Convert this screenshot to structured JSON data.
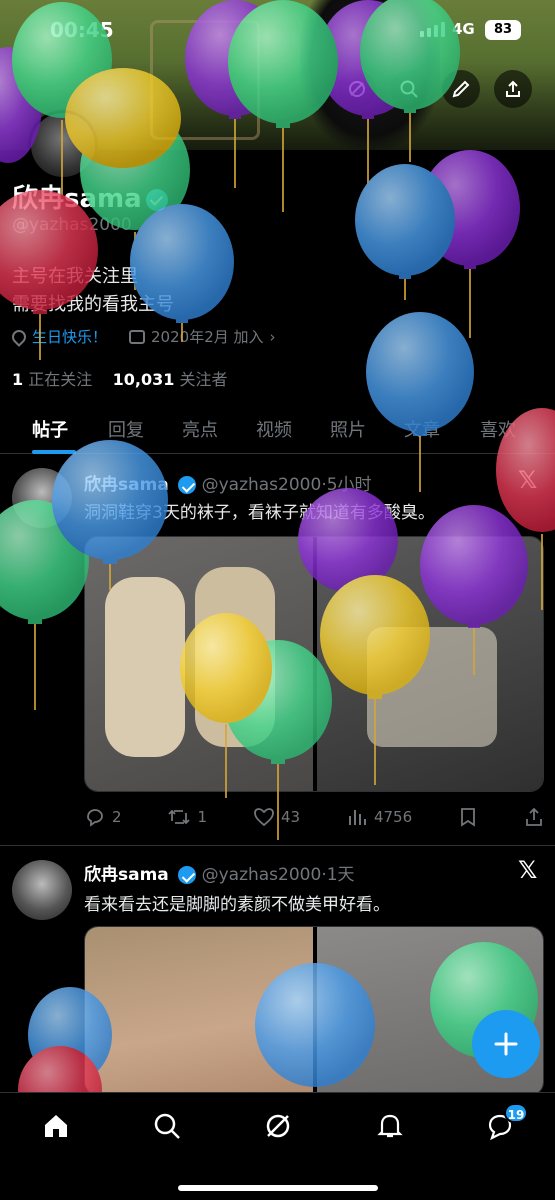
{
  "status_bar": {
    "time": "00:45",
    "network": "4G",
    "battery": "83"
  },
  "profile": {
    "name": "欣冉sama",
    "handle": "@yazhas2000",
    "bio_line1": "主号在我关注里",
    "bio_line2": "需要找我的看我主号",
    "birthday": "生日快乐！",
    "joined": "2020年2月 加入",
    "following_count": "1",
    "following_label": "正在关注",
    "followers_count": "10,031",
    "followers_label": "关注者"
  },
  "tabs": [
    "帖子",
    "回复",
    "亮点",
    "视频",
    "照片",
    "文章",
    "喜欢"
  ],
  "posts": [
    {
      "name": "欣冉sama",
      "handle": "@yazhas2000",
      "time": "·5小时",
      "text": "洞洞鞋穿3天的袜子，看袜子就知道有多酸臭。",
      "replies": "2",
      "reposts": "1",
      "likes": "43",
      "views": "4756"
    },
    {
      "name": "欣冉sama",
      "handle": "@yazhas2000",
      "time": "·1天",
      "text": "看来看去还是脚脚的素颜不做美甲好看。"
    }
  ],
  "nav": {
    "messages_badge": "19"
  },
  "icons": {
    "header": [
      "search-icon",
      "edit-icon",
      "share-icon"
    ],
    "actions": [
      "reply-icon",
      "repost-icon",
      "like-icon",
      "views-icon",
      "bookmark-icon",
      "share-icon"
    ],
    "nav": [
      "home-icon",
      "search-icon",
      "grok-icon",
      "bell-icon",
      "messages-icon"
    ]
  },
  "colors": {
    "accent": "#1d9bf0",
    "background": "#000000",
    "muted": "#71767b"
  }
}
